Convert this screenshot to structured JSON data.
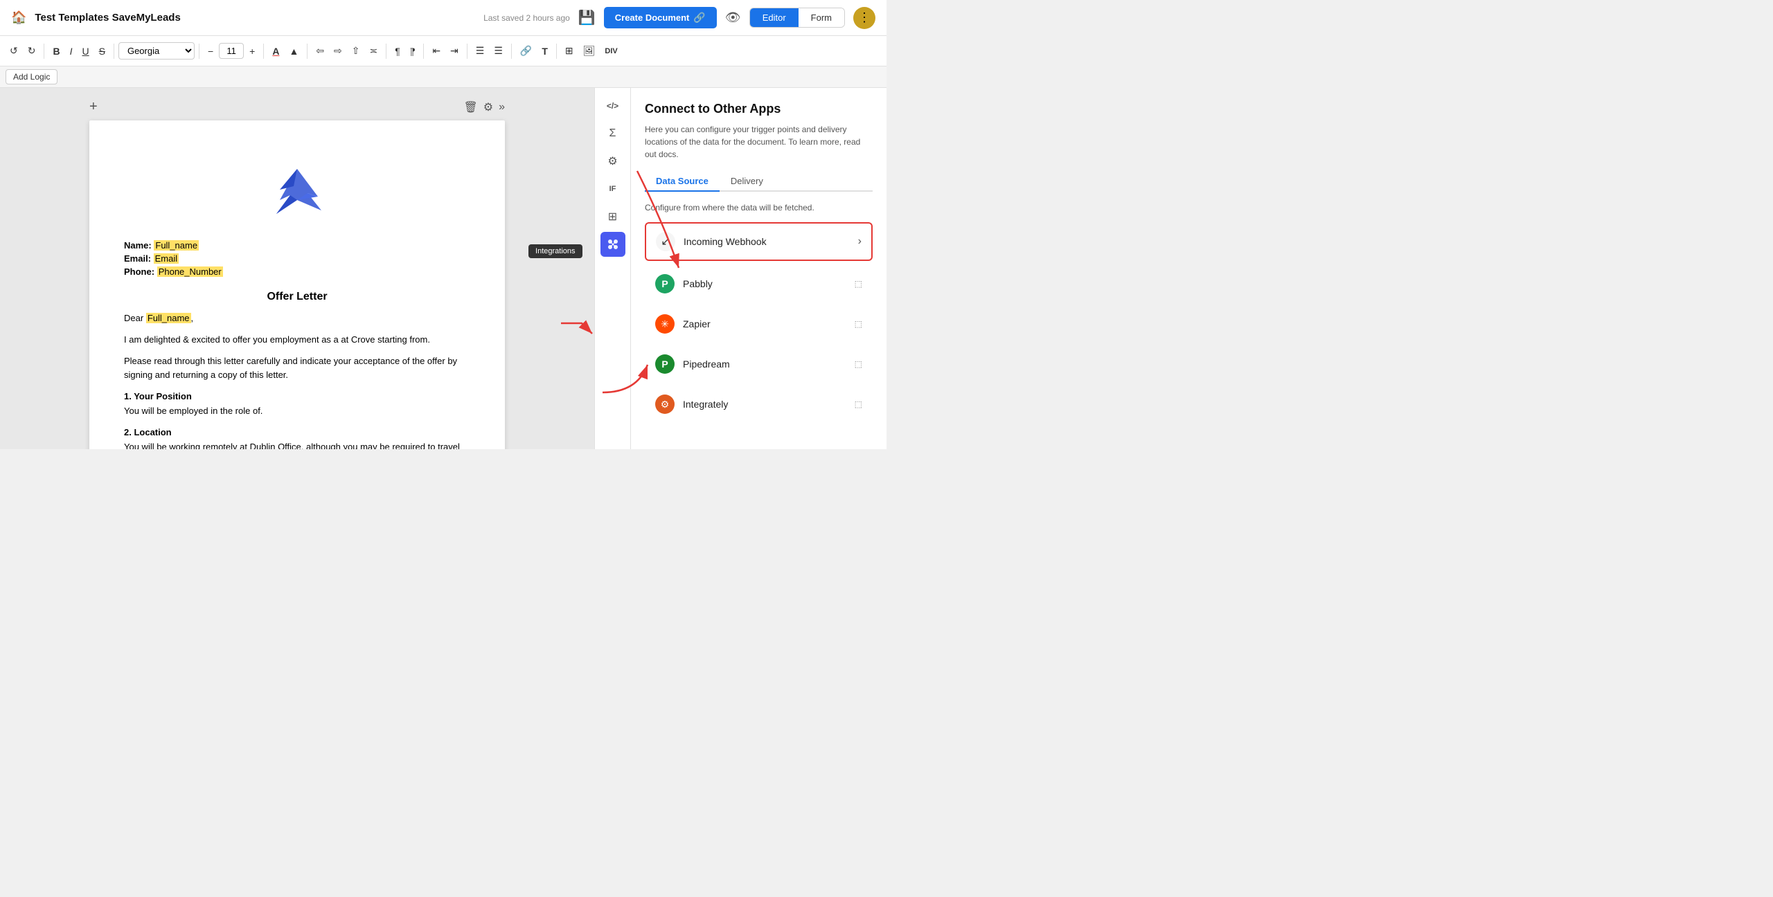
{
  "header": {
    "home_icon": "🏠",
    "title": "Test Templates SaveMyLeads",
    "saved_text": "Last saved 2 hours ago",
    "create_doc_label": "Create Document",
    "tab_editor": "Editor",
    "tab_form": "Form"
  },
  "toolbar": {
    "undo": "↺",
    "redo": "↻",
    "bold": "B",
    "italic": "I",
    "underline": "U",
    "strikethrough": "S",
    "font": "Georgia",
    "font_size": "11",
    "minus": "−",
    "plus": "+",
    "text_color": "A",
    "highlight": "▲",
    "align_left": "≡",
    "align_center": "≡",
    "align_right": "≡",
    "align_justify": "≡",
    "para1": "¶",
    "para2": "¶",
    "indent_left": "⇤",
    "indent_right": "⇥",
    "list_ordered": "☰",
    "list_unordered": "☰",
    "link": "🔗",
    "typography": "T",
    "table": "⊞",
    "image": "🖼",
    "div": "DIV"
  },
  "add_logic_btn": "Add Logic",
  "doc": {
    "name_label": "Name:",
    "name_value": "Full_name",
    "email_label": "Email:",
    "email_value": "Email",
    "phone_label": "Phone:",
    "phone_value": "Phone_Number",
    "section_title": "Offer Letter",
    "dear_prefix": "Dear",
    "dear_name": "Full_name",
    "para1": "I am delighted & excited to offer you employment as a at Crove starting from.",
    "para2": "Please read through this letter carefully and indicate your acceptance of the offer by signing and returning a copy of this letter.",
    "sub1": "1. Your Position",
    "sub1_text": "You will be employed in the role of.",
    "sub2": "2. Location",
    "sub2_text": "You will be working remotely at Dublin Office, although you may be required to travel as part of your job."
  },
  "side_icons": {
    "code": "</>",
    "sigma": "Σ",
    "gear": "⚙",
    "if": "IF",
    "grid": "⊞",
    "integrations": "⚡"
  },
  "integrations_tooltip": "Integrations",
  "right_panel": {
    "title": "Connect to Other Apps",
    "desc": "Here you can configure your trigger points and delivery locations of the data for the document. To learn more, read out docs.",
    "tab_data_source": "Data Source",
    "tab_delivery": "Delivery",
    "ds_desc": "Configure from where the data will be fetched.",
    "integrations": [
      {
        "name": "Incoming Webhook",
        "icon": "↙",
        "icon_bg": "#fff",
        "icon_color": "#333",
        "active": true,
        "type": "arrow"
      },
      {
        "name": "Pabbly",
        "icon": "P",
        "icon_bg": "#1da462",
        "icon_color": "#fff",
        "active": false,
        "type": "text"
      },
      {
        "name": "Zapier",
        "icon": "✳",
        "icon_bg": "#ff4a00",
        "icon_color": "#fff",
        "active": false,
        "type": "text"
      },
      {
        "name": "Pipedream",
        "icon": "P",
        "icon_bg": "#1a8a2e",
        "icon_color": "#fff",
        "active": false,
        "type": "text"
      },
      {
        "name": "Integrately",
        "icon": "⚙",
        "icon_bg": "#e05a1f",
        "icon_color": "#fff",
        "active": false,
        "type": "text"
      }
    ]
  }
}
